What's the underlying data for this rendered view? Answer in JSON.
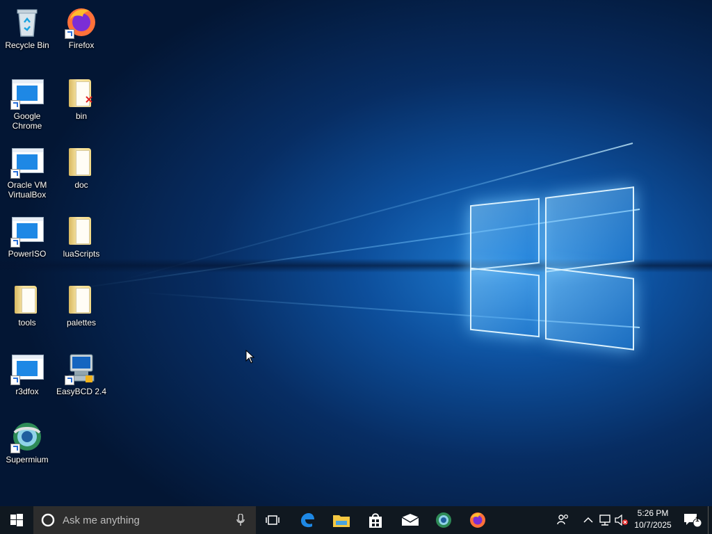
{
  "desktop": {
    "icons": [
      {
        "label": "Recycle Bin"
      },
      {
        "label": "Firefox"
      },
      {
        "label": "Google Chrome"
      },
      {
        "label": "bin"
      },
      {
        "label": "Oracle VM VirtualBox"
      },
      {
        "label": "doc"
      },
      {
        "label": "PowerISO"
      },
      {
        "label": "luaScripts"
      },
      {
        "label": "tools"
      },
      {
        "label": "palettes"
      },
      {
        "label": "r3dfox"
      },
      {
        "label": "EasyBCD 2.4"
      },
      {
        "label": "Supermium"
      }
    ]
  },
  "taskbar": {
    "search_placeholder": "Ask me anything",
    "clock_time": "5:26 PM",
    "clock_date": "10/7/2025",
    "notification_count": "1",
    "pinned": [
      "task-view-icon",
      "edge-icon",
      "file-explorer-icon",
      "store-icon",
      "mail-icon",
      "supermium-icon",
      "firefox-icon"
    ]
  },
  "colors": {
    "taskbar": "#101820",
    "search_box": "#2d2d2d",
    "accent": "#1e88e5"
  }
}
